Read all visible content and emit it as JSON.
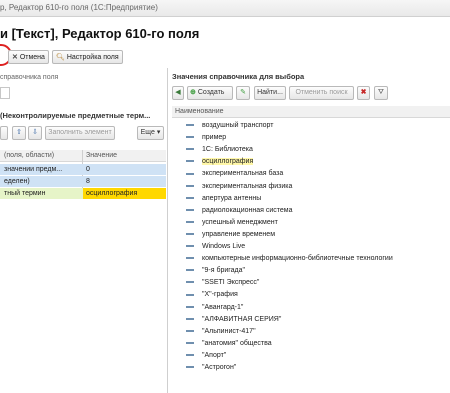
{
  "window": {
    "title": "р, Редактор 610-го поля (1С:Предприятие)",
    "heading": "и [Текст], Редактор 610-го поля"
  },
  "top_toolbar": {
    "cancel_label": "Отмена",
    "field_settings_label": "Настройка поля"
  },
  "left": {
    "search_label": "справочника поля",
    "section_title": "(Неконтролируемые предметные терм...",
    "fill_button_label": "Заполнить элемент",
    "more_button_label": "Еще",
    "table_headers": [
      "(поля, области)",
      "Значение"
    ],
    "rows": [
      {
        "name": "значении предм...",
        "value": "0"
      },
      {
        "name": "еделен)",
        "value": "8"
      },
      {
        "name": "тный термин",
        "value": "осциллография"
      }
    ]
  },
  "right": {
    "title": "Значения справочника для выбора",
    "toolbar": {
      "create_label": "Создать",
      "find_label": "Найти...",
      "cancel_search_label": "Отменить поиск"
    },
    "column_header": "Наименование",
    "items": [
      "воздушный транспорт",
      "пример",
      "1С: Библиотека",
      "осциллография",
      "экспериментальная база",
      "экспериментальная физика",
      "апертура антенны",
      "радиолокационная система",
      "успешный менеджмент",
      "управление временем",
      "Windows Live",
      "компьютерные информационно-библиотечные технологии",
      "\"9-я бригада\"",
      "\"SSETI Экспресс\"",
      "\"X\"-графия",
      "\"Авангард-1\"",
      "\"АЛФАВИТНАЯ СЕРИЯ\"",
      "\"Альпинист-417\"",
      "\"анатомия\" общества",
      "\"Апорт\"",
      "\"Астрогон\""
    ],
    "highlighted_index": 3
  },
  "colors": {
    "selection_yellow": "#fff7a8",
    "row_blue": "#cfe2f5",
    "accent_green": "#3a9a3a",
    "delete_red": "#c62828",
    "annotation_red": "#d22222"
  }
}
